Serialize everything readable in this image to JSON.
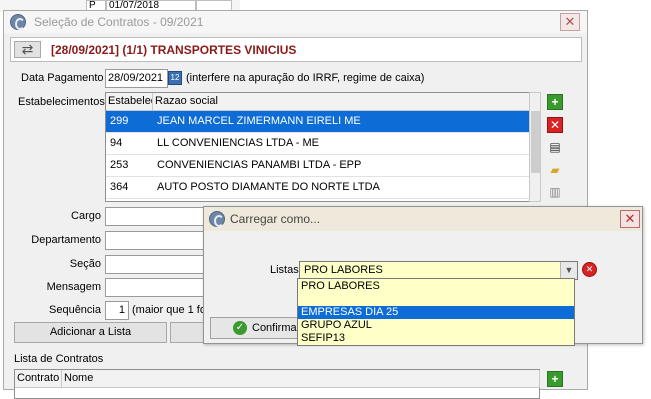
{
  "background_window": {
    "cell_p": "P",
    "cell_date": "01/07/2018"
  },
  "main_dialog": {
    "title": "Seleção de Contratos - 09/2021",
    "close_glyph": "✕",
    "header": "[28/09/2021] (1/1) TRANSPORTES VINICIUS",
    "data_pagamento_label": "Data Pagamento",
    "data_pagamento_value": "28/09/2021",
    "calendar_glyph": "12",
    "irrf_note": "(interfere na apuração do IRRF, regime de caixa)",
    "estabelecimentos_label": "Estabelecimentos",
    "grid": {
      "columns": [
        "Estabelecimento",
        "Razao social"
      ],
      "rows": [
        {
          "code": "299",
          "name": "JEAN MARCEL ZIMERMANN EIRELI ME",
          "selected": true
        },
        {
          "code": "94",
          "name": "LL CONVENIENCIAS LTDA - ME",
          "selected": false
        },
        {
          "code": "253",
          "name": "CONVENIENCIAS PANAMBI LTDA - EPP",
          "selected": false
        },
        {
          "code": "364",
          "name": "AUTO POSTO DIAMANTE DO NORTE LTDA",
          "selected": false
        }
      ]
    },
    "side_icons": {
      "add": "+",
      "remove": "✕",
      "save": "▤",
      "open": "▰",
      "trash": "▥"
    },
    "labels": {
      "cargo": "Cargo",
      "departamento": "Departamento",
      "secao": "Seção",
      "mensagem": "Mensagem",
      "sequencia": "Sequência"
    },
    "sequencia_value": "1",
    "sequencia_note": "(maior que 1 fo",
    "add_button": "Adicionar a Lista",
    "lista_label": "Lista de Contratos",
    "list_columns": [
      "Contrato",
      "Nome"
    ],
    "list_add": "+"
  },
  "overlay_dialog": {
    "title": "Carregar como...",
    "close_glyph": "✕",
    "listas_label": "Listas",
    "combo_value": "PRO LABORES",
    "combo_arrow": "▼",
    "clear_glyph": "✕",
    "confirm_label": "Confirmar",
    "confirm_glyph": "✓"
  },
  "dropdown": {
    "items": [
      {
        "label": "PRO LABORES",
        "selected": false
      },
      {
        "label": "",
        "selected": false
      },
      {
        "label": "EMPRESAS DIA 25",
        "selected": true
      },
      {
        "label": "GRUPO AZUL",
        "selected": false
      },
      {
        "label": "SEFIP13",
        "selected": false
      }
    ]
  },
  "colors": {
    "selection": "#0e6cd6",
    "header_text": "#8a1a1a",
    "combo_bg": "#ffffc8",
    "close_red": "#b52c2c",
    "add_green": "#3a9a2e"
  }
}
